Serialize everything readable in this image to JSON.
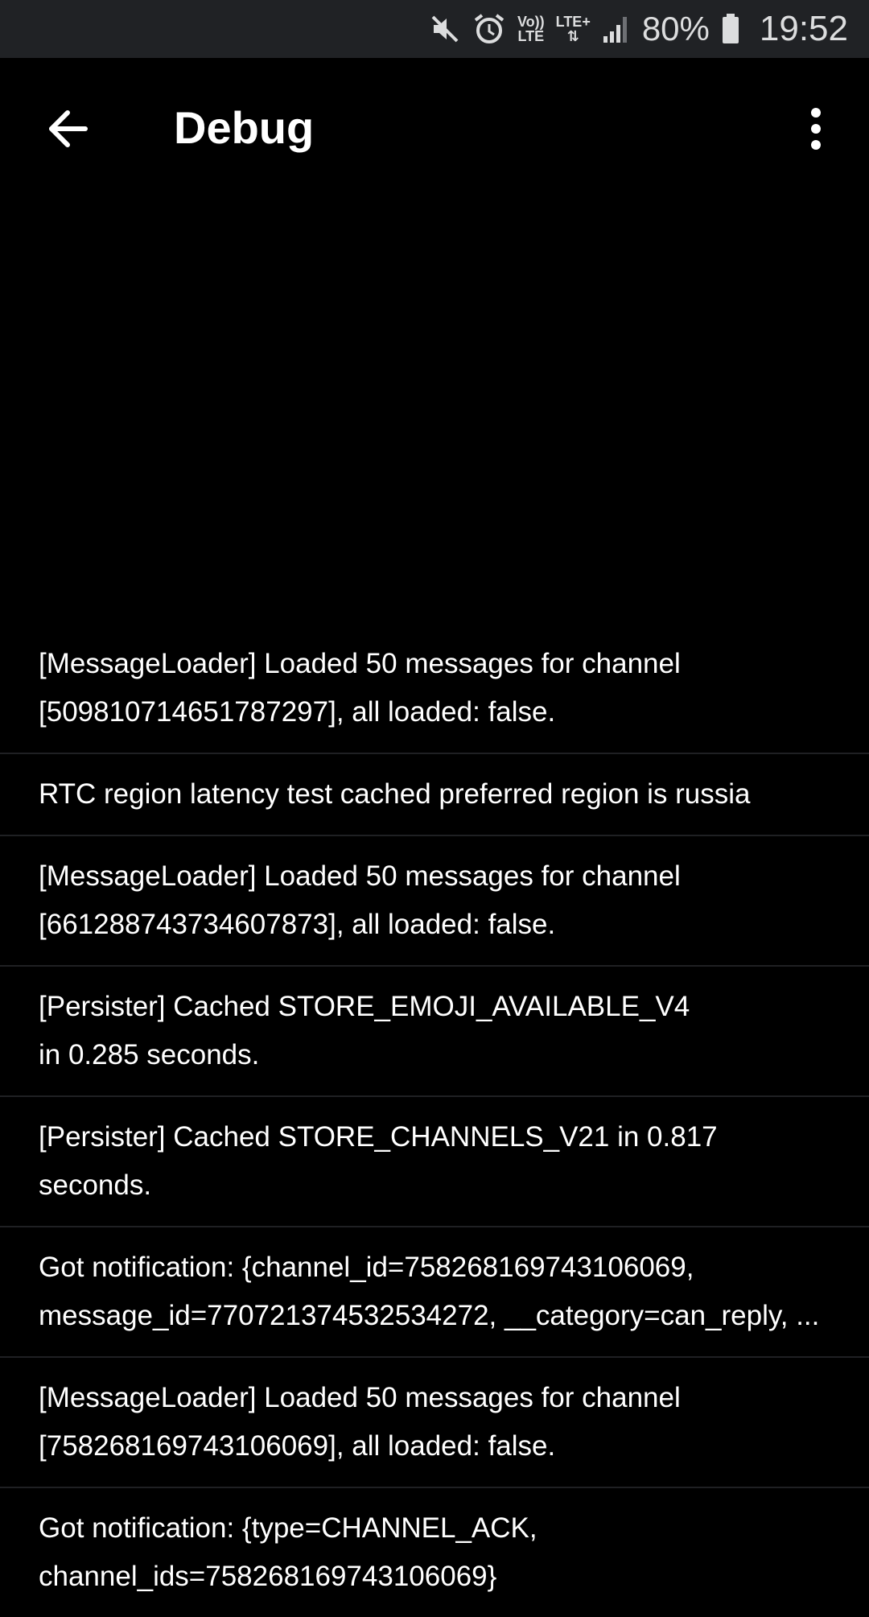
{
  "status_bar": {
    "icons": [
      "mute-icon",
      "alarm-icon",
      "volte-icon",
      "lte-plus-icon",
      "signal-icon",
      "battery-icon"
    ],
    "volte_label": "Vo))\nLTE",
    "lte_label": "LTE+",
    "battery": "80%",
    "time": "19:52"
  },
  "app_bar": {
    "title": "Debug",
    "back_icon": "arrow-left-icon",
    "menu_icon": "more-vertical-icon"
  },
  "logs": [
    "[MessageLoader] Loaded 50 messages for channel\n[509810714651787297], all loaded: false.",
    "RTC region latency test cached preferred region is russia",
    "[MessageLoader] Loaded 50 messages for channel\n[661288743734607873], all loaded: false.",
    "[Persister] Cached STORE_EMOJI_AVAILABLE_V4\nin 0.285 seconds.",
    "[Persister] Cached STORE_CHANNELS_V21 in 0.817 seconds.",
    "Got notification: {channel_id=758268169743106069,\nmessage_id=770721374532534272, __category=can_reply, ...",
    "[MessageLoader] Loaded 50 messages for channel\n[758268169743106069], all loaded: false.",
    "Got notification: {type=CHANNEL_ACK,\nchannel_ids=758268169743106069}"
  ],
  "colors": {
    "background": "#000000",
    "status_bar": "#202225",
    "divider": "#1f2023",
    "text": "#ffffff"
  }
}
